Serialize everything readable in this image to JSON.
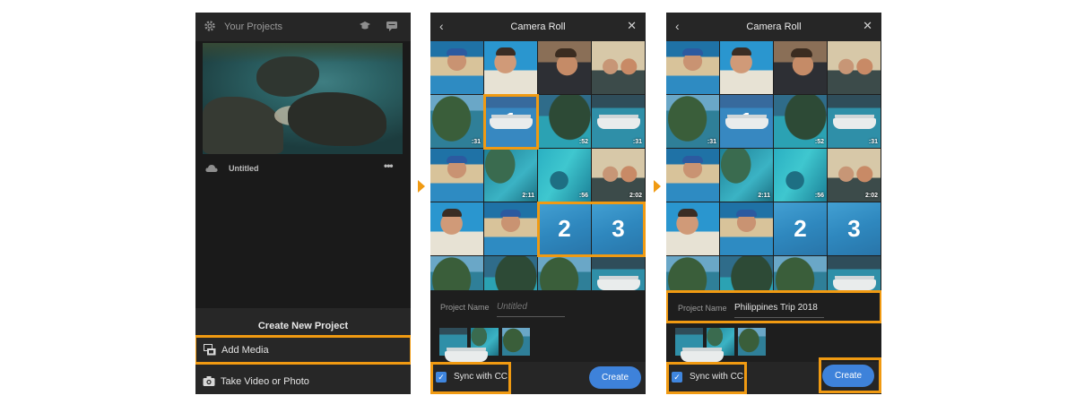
{
  "colors": {
    "highlight": "#f09a12",
    "accent": "#3e82da",
    "background": "#1c1c1c"
  },
  "home": {
    "header": {
      "title": "Your Projects",
      "settings_icon": "gear-icon",
      "learn_icon": "graduation-cap-icon",
      "feedback_icon": "chat-bubble-icon"
    },
    "project": {
      "name": "Untitled",
      "cloud_icon": "cloud-icon",
      "more_label": "•••"
    },
    "sheet": {
      "title": "Create New Project",
      "items": [
        {
          "label": "Add Media",
          "icon": "add-media-icon"
        },
        {
          "label": "Take Video or Photo",
          "icon": "camera-icon"
        }
      ]
    }
  },
  "camera_roll_1": {
    "header": {
      "back": "‹",
      "title": "Camera Roll",
      "close": "✕"
    },
    "tiles": [
      {
        "kind": "selfie",
        "dur": ""
      },
      {
        "kind": "selfie2",
        "dur": ""
      },
      {
        "kind": "selfie3",
        "dur": ""
      },
      {
        "kind": "duo",
        "dur": ""
      },
      {
        "kind": "island",
        "dur": ":31"
      },
      {
        "kind": "boat",
        "dur": "",
        "sel": "1"
      },
      {
        "kind": "cliff",
        "dur": ":52"
      },
      {
        "kind": "boat",
        "dur": ":31"
      },
      {
        "kind": "selfie",
        "dur": ""
      },
      {
        "kind": "lagoon",
        "dur": "2:11"
      },
      {
        "kind": "reef",
        "dur": ":56"
      },
      {
        "kind": "duo",
        "dur": "2:02"
      },
      {
        "kind": "selfie2",
        "dur": ""
      },
      {
        "kind": "selfie",
        "dur": ""
      },
      {
        "kind": "water",
        "dur": "",
        "sel": "2"
      },
      {
        "kind": "water",
        "dur": "",
        "sel": "3"
      },
      {
        "kind": "island",
        "dur": ""
      },
      {
        "kind": "cliff",
        "dur": ""
      },
      {
        "kind": "island",
        "dur": ""
      },
      {
        "kind": "boat",
        "dur": ""
      }
    ],
    "project_name": {
      "label": "Project Name",
      "placeholder": "Untitled"
    },
    "sync_label": "Sync with CC",
    "create_label": "Create"
  },
  "camera_roll_2": {
    "header": {
      "back": "‹",
      "title": "Camera Roll",
      "close": "✕"
    },
    "tiles": [
      {
        "kind": "selfie",
        "dur": ""
      },
      {
        "kind": "selfie2",
        "dur": ""
      },
      {
        "kind": "selfie3",
        "dur": ""
      },
      {
        "kind": "duo",
        "dur": ""
      },
      {
        "kind": "island",
        "dur": ":31"
      },
      {
        "kind": "boat",
        "dur": "",
        "sel": "1"
      },
      {
        "kind": "cliff",
        "dur": ":52"
      },
      {
        "kind": "boat",
        "dur": ":31"
      },
      {
        "kind": "selfie",
        "dur": ""
      },
      {
        "kind": "lagoon",
        "dur": "2:11"
      },
      {
        "kind": "reef",
        "dur": ":56"
      },
      {
        "kind": "duo",
        "dur": "2:02"
      },
      {
        "kind": "selfie2",
        "dur": ""
      },
      {
        "kind": "selfie",
        "dur": ""
      },
      {
        "kind": "water",
        "dur": "",
        "sel": "2"
      },
      {
        "kind": "water",
        "dur": "",
        "sel": "3"
      },
      {
        "kind": "island",
        "dur": ""
      },
      {
        "kind": "cliff",
        "dur": ""
      },
      {
        "kind": "island",
        "dur": ""
      },
      {
        "kind": "boat",
        "dur": ""
      }
    ],
    "project_name": {
      "label": "Project Name",
      "value": "Philippines Trip 2018"
    },
    "sync_label": "Sync with CC",
    "create_label": "Create"
  }
}
